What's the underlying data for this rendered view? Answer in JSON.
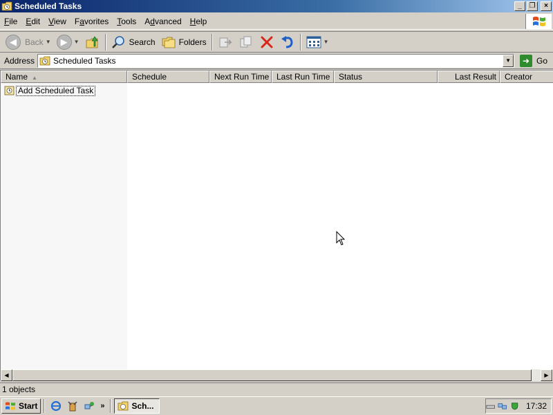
{
  "window": {
    "title": "Scheduled Tasks",
    "controls": {
      "minimize": "_",
      "restore": "❐",
      "close": "×"
    }
  },
  "menubar": {
    "items": [
      {
        "label": "File",
        "accel": "F",
        "rest": "ile"
      },
      {
        "label": "Edit",
        "accel": "E",
        "rest": "dit"
      },
      {
        "label": "View",
        "accel": "V",
        "rest": "iew"
      },
      {
        "label": "Favorites",
        "accel": "",
        "pre": "F",
        "accel2": "a",
        "rest": "vorites"
      },
      {
        "label": "Tools",
        "accel": "T",
        "rest": "ools"
      },
      {
        "label": "Advanced",
        "pre": "A",
        "accel2": "d",
        "rest": "vanced"
      },
      {
        "label": "Help",
        "accel": "H",
        "rest": "elp"
      }
    ]
  },
  "toolbar": {
    "back_label": "Back",
    "search_label": "Search",
    "folders_label": "Folders"
  },
  "address": {
    "label": "Address",
    "value": "Scheduled Tasks",
    "go_label": "Go"
  },
  "listview": {
    "columns": [
      "Name",
      "Schedule",
      "Next Run Time",
      "Last Run Time",
      "Status",
      "Last Result",
      "Creator"
    ],
    "rows": [
      {
        "name": "Add Scheduled Task"
      }
    ]
  },
  "statusbar": {
    "text": "1 objects"
  },
  "taskbar": {
    "start_label": "Start",
    "task_button_label": "Sch...",
    "overflow": "»",
    "clock": "17:32"
  },
  "colors": {
    "titlebar_start": "#0a246a",
    "titlebar_end": "#a6caf0",
    "face": "#d4d0c8",
    "window": "#ffffff"
  }
}
